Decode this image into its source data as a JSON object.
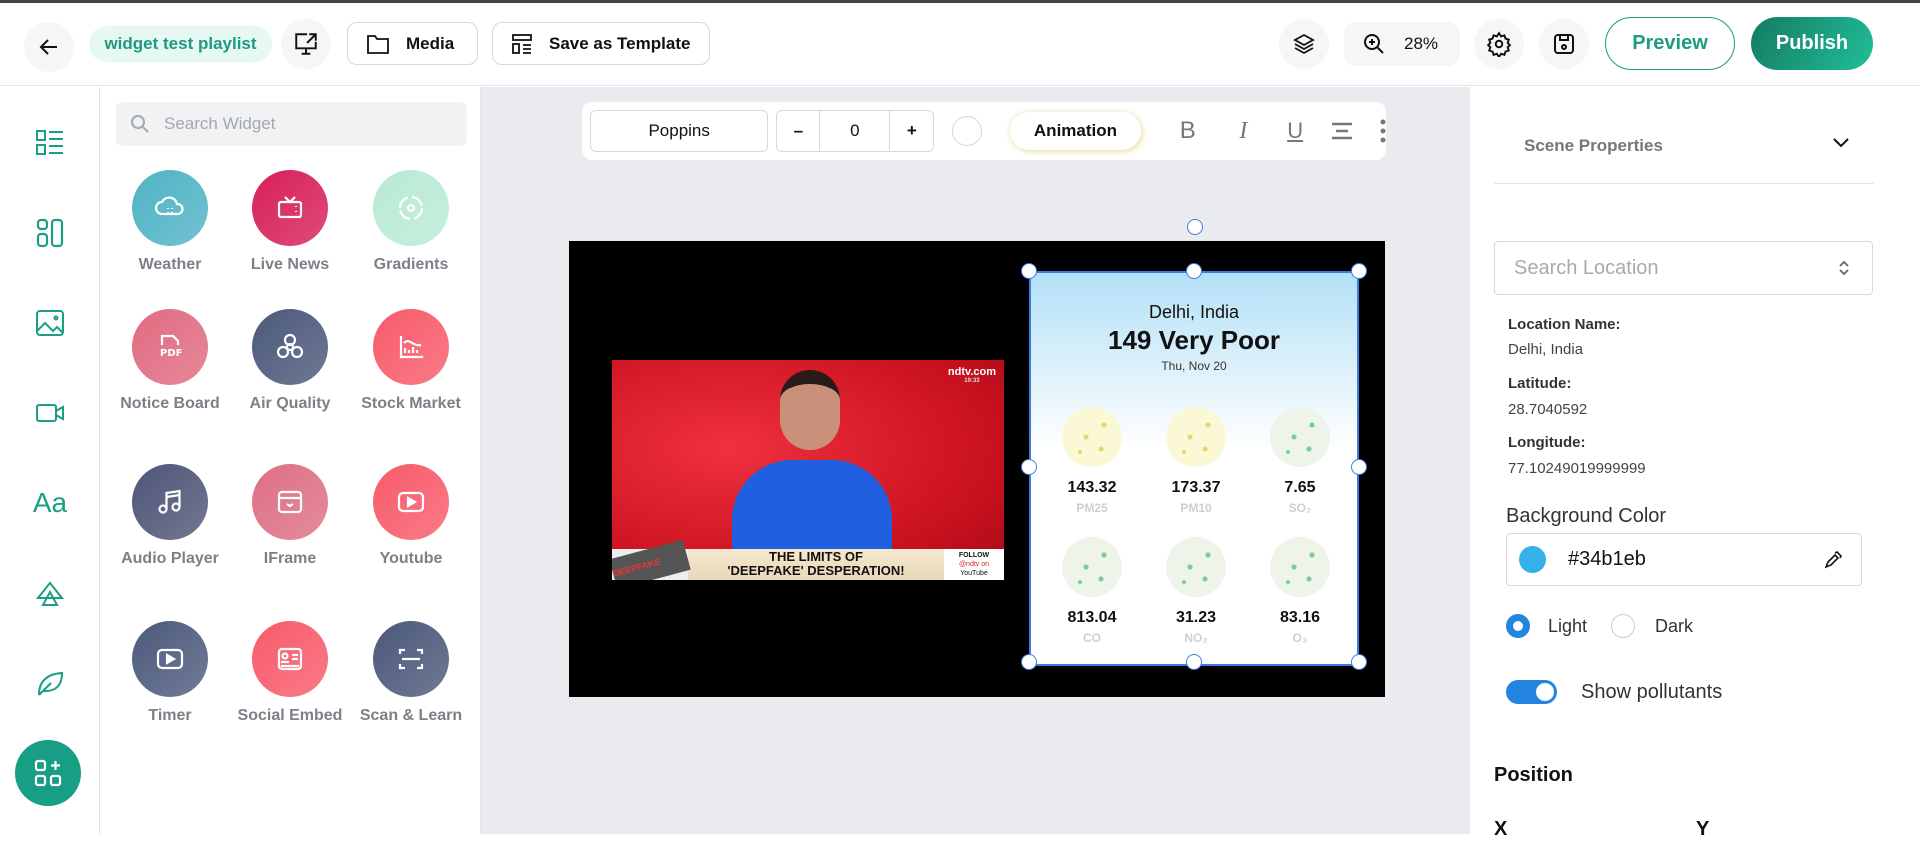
{
  "header": {
    "playlist_name": "widget test playlist",
    "media_label": "Media",
    "save_template_label": "Save as Template",
    "zoom": "28%",
    "preview_label": "Preview",
    "publish_label": "Publish"
  },
  "widget_panel": {
    "search_placeholder": "Search Widget",
    "widgets": [
      {
        "label": "Weather",
        "icon": "cloud-icon",
        "color": "#4fb3c4"
      },
      {
        "label": "Live News",
        "icon": "tv-icon",
        "color": "#d81f57"
      },
      {
        "label": "Gradients",
        "icon": "gradient-icon",
        "color": "#b8ead4"
      },
      {
        "label": "Notice Board",
        "icon": "pdf-icon",
        "color": "#e06b80"
      },
      {
        "label": "Air Quality",
        "icon": "fan-icon",
        "color": "#4b5879"
      },
      {
        "label": "Stock Market",
        "icon": "chart-icon",
        "color": "#f85a6a"
      },
      {
        "label": "Audio Player",
        "icon": "music-icon",
        "color": "#4f5577"
      },
      {
        "label": "IFrame",
        "icon": "iframe-icon",
        "color": "#dd6f84"
      },
      {
        "label": "Youtube",
        "icon": "youtube-icon",
        "color": "#f85a6a"
      },
      {
        "label": "Timer",
        "icon": "play-icon",
        "color": "#4c5a7c"
      },
      {
        "label": "Social Embed",
        "icon": "id-card-icon",
        "color": "#f85a6a"
      },
      {
        "label": "Scan & Learn",
        "icon": "scan-icon",
        "color": "#4b5879"
      }
    ]
  },
  "toolbar": {
    "font": "Poppins",
    "size": "0",
    "minus": "–",
    "plus": "+",
    "animation_label": "Animation",
    "bold": "B",
    "italic": "I",
    "underline": "U"
  },
  "video": {
    "channel": "ndtv.com",
    "time": "19:33",
    "headline_1": "THE LIMITS OF",
    "headline_2": "'DEEPFAKE' DESPERATION!",
    "follow_1": "FOLLOW",
    "follow_2": "@ndtv on",
    "follow_3": "YouTube",
    "tag": "DEEPFAKE"
  },
  "air_widget": {
    "location": "Delhi, India",
    "aqi": "149 Very Poor",
    "date": "Thu, Nov 20",
    "pollutants": [
      {
        "value": "143.32",
        "label": "PM25",
        "tone": "yellow"
      },
      {
        "value": "173.37",
        "label": "PM10",
        "tone": "yellow"
      },
      {
        "value": "7.65",
        "label": "SO₂",
        "tone": "green"
      },
      {
        "value": "813.04",
        "label": "CO",
        "tone": "green"
      },
      {
        "value": "31.23",
        "label": "NO₂",
        "tone": "green"
      },
      {
        "value": "83.16",
        "label": "O₃",
        "tone": "green"
      }
    ]
  },
  "properties": {
    "section_title": "Scene Properties",
    "search_placeholder": "Search Location",
    "location_name_label": "Location Name:",
    "location_name": "Delhi, India",
    "latitude_label": "Latitude:",
    "latitude": "28.7040592",
    "longitude_label": "Longitude:",
    "longitude": "77.10249019999999",
    "bg_color_label": "Background Color",
    "bg_color": "#34b1eb",
    "theme_light": "Light",
    "theme_dark": "Dark",
    "theme_selected": "Light",
    "show_pollutants_label": "Show pollutants",
    "show_pollutants": true,
    "position_title": "Position",
    "x_label": "X",
    "y_label": "Y"
  }
}
